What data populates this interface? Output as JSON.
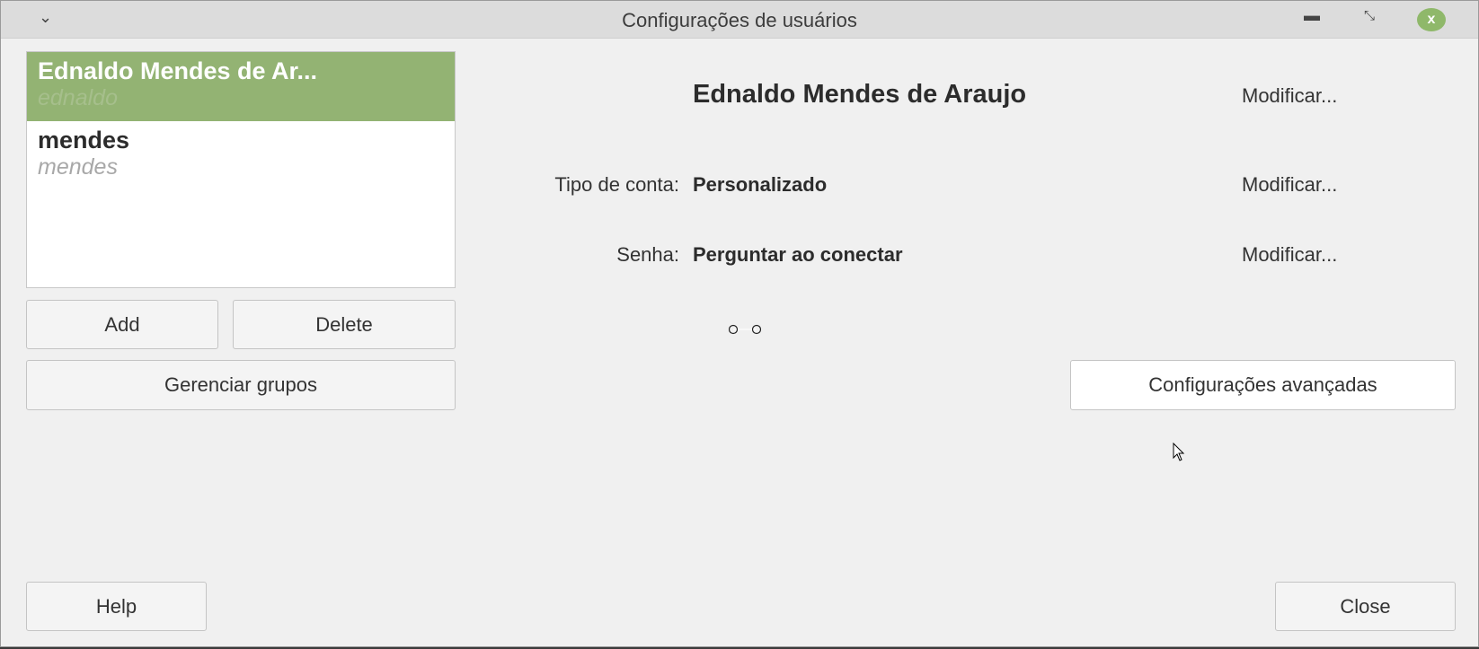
{
  "window": {
    "title": "Configurações de usuários",
    "menu_icon": "chevron-down-icon",
    "minimize_icon": "minimize-icon",
    "restore_icon": "restore-icon",
    "close_icon": "close-icon"
  },
  "users": [
    {
      "name": "Ednaldo Mendes de Ar...",
      "username": "ednaldo",
      "selected": true
    },
    {
      "name": "mendes",
      "username": "mendes",
      "selected": false
    }
  ],
  "buttons": {
    "add": "Add",
    "delete": "Delete",
    "groups": "Gerenciar grupos",
    "advanced": "Configurações avançadas",
    "help": "Help",
    "close": "Close"
  },
  "details": {
    "full_name": "Ednaldo Mendes de Araujo",
    "account_type_label": "Tipo de conta:",
    "account_type": "Personalizado",
    "password_label": "Senha:",
    "password": "Perguntar ao conectar",
    "modify": "Modificar..."
  },
  "colors": {
    "selection": "#93b373",
    "close_button": "#8fb86a"
  }
}
